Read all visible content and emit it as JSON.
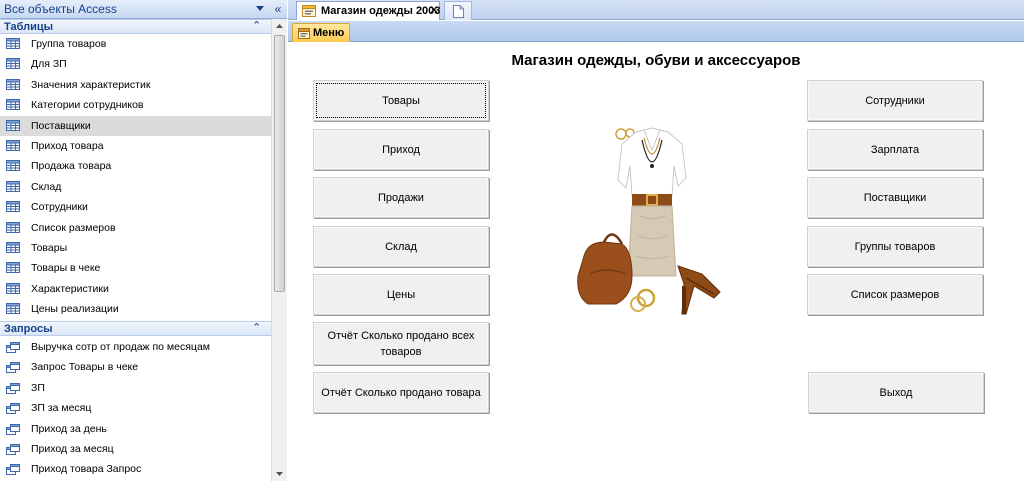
{
  "nav": {
    "title": "Все объекты Access",
    "collapse_glyph": "«",
    "groups": {
      "tables": {
        "label": "Таблицы",
        "toggle": "⌃",
        "items": [
          {
            "label": "Группа товаров"
          },
          {
            "label": "Для ЗП"
          },
          {
            "label": "Значения характеристик"
          },
          {
            "label": "Категории сотрудников"
          },
          {
            "label": "Поставщики"
          },
          {
            "label": "Приход товара"
          },
          {
            "label": "Продажа товара"
          },
          {
            "label": "Склад"
          },
          {
            "label": "Сотрудники"
          },
          {
            "label": "Список размеров"
          },
          {
            "label": "Товары"
          },
          {
            "label": "Товары в чеке"
          },
          {
            "label": "Характеристики"
          },
          {
            "label": "Цены реализации"
          }
        ],
        "selected_index": 4
      },
      "queries": {
        "label": "Запросы",
        "toggle": "⌃",
        "items": [
          {
            "label": "Выручка сотр от продаж по месяцам"
          },
          {
            "label": "Запрос Товары в чеке"
          },
          {
            "label": "ЗП"
          },
          {
            "label": "ЗП за месяц"
          },
          {
            "label": "Приход за день"
          },
          {
            "label": "Приход за месяц"
          },
          {
            "label": "Приход товара Запрос"
          }
        ]
      }
    }
  },
  "document": {
    "tab": {
      "label": "Магазин одежды 2003",
      "close_glyph": "✕",
      "icon": "form-icon"
    },
    "new_tab_icon": "document-icon",
    "menu_tab": {
      "label": "Меню",
      "icon": "form-icon"
    },
    "title": "Магазин одежды, обуви и аксессуаров",
    "left_buttons": {
      "goods": "Товары",
      "income": "Приход",
      "sales": "Продажи",
      "warehouse": "Склад",
      "prices": "Цены",
      "report_all": "Отчёт Сколько продано всех товаров",
      "report_one": "Отчёт Сколько продано товара"
    },
    "right_buttons": {
      "employees": "Сотрудники",
      "salary": "Зарплата",
      "suppliers": "Поставщики",
      "groups": "Группы товаров",
      "sizes": "Список размеров",
      "exit": "Выход"
    }
  },
  "colors": {
    "nav_text": "#15428b",
    "menu_tab": "#ffc94d",
    "selected_item": "#dbdbdb"
  }
}
